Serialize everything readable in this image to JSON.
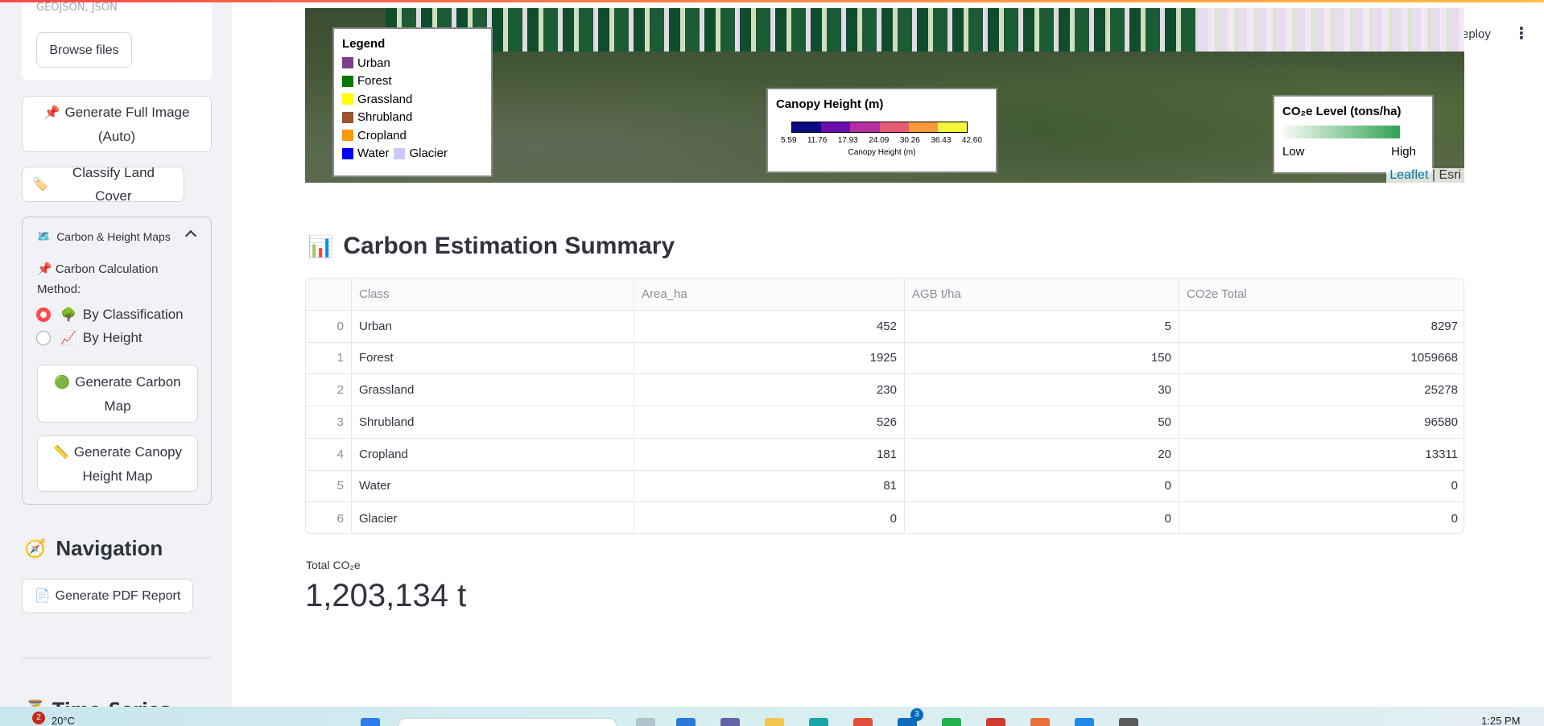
{
  "sidebar": {
    "upload_hint": "GEOJSON, JSON",
    "browse_label": "Browse files",
    "generate_full_label": "Generate Full Image (Auto)",
    "generate_full_emoji": "📌",
    "classify_label": "Classify Land Cover",
    "classify_emoji": "🏷️",
    "expander": {
      "title": "Carbon & Height Maps",
      "emoji": "🗺️",
      "method_label": "📌 Carbon Calculation Method:",
      "options": [
        {
          "emoji": "🌳",
          "label": "By Classification",
          "selected": true
        },
        {
          "emoji": "📈",
          "label": "By Height",
          "selected": false
        }
      ],
      "carbon_btn_emoji": "🟢",
      "carbon_btn_label": "Generate Carbon Map",
      "canopy_btn_emoji": "📏",
      "canopy_btn_label": "Generate Canopy Height Map"
    },
    "nav_title": "Navigation",
    "nav_emoji": "🧭",
    "pdf_emoji": "📄",
    "pdf_label": "Generate PDF Report",
    "cut_title": "⏳ Time-Series Analysis"
  },
  "header": {
    "deploy_label": "eploy",
    "menu_icon": "⋮"
  },
  "map": {
    "legend": {
      "title": "Legend",
      "items": [
        {
          "label": "Urban",
          "color": "#7b3f8c"
        },
        {
          "label": "Forest",
          "color": "#007a00"
        },
        {
          "label": "Grassland",
          "color": "#ffff00"
        },
        {
          "label": "Shrubland",
          "color": "#a0522d"
        },
        {
          "label": "Cropland",
          "color": "#ff9900"
        }
      ],
      "water": {
        "label": "Water",
        "color": "#0000ff"
      },
      "glacier": {
        "label": "Glacier",
        "color": "#c8c8ff"
      }
    },
    "canopy": {
      "title": "Canopy Height (m)",
      "colors": [
        "#0b0b80",
        "#6a0dad",
        "#b52fa0",
        "#e65c6e",
        "#f99a3a",
        "#f5f53b"
      ],
      "ticks": [
        "5.59",
        "11.76",
        "17.93",
        "24.09",
        "30.26",
        "36.43",
        "42.60"
      ],
      "caption": "Canopy Height (m)"
    },
    "co2": {
      "title": "CO₂e Level (tons/ha)",
      "low": "Low",
      "high": "High"
    },
    "attribution": {
      "leaflet": "Leaflet",
      "sep": " | ",
      "esri": "Esri"
    }
  },
  "summary": {
    "title": "Carbon Estimation Summary",
    "emoji": "📊",
    "columns": [
      "Class",
      "Area_ha",
      "AGB t/ha",
      "CO2e Total"
    ],
    "rows": [
      {
        "idx": "0",
        "class": "Urban",
        "area": "452",
        "agb": "5",
        "co2": "8297"
      },
      {
        "idx": "1",
        "class": "Forest",
        "area": "1925",
        "agb": "150",
        "co2": "1059668"
      },
      {
        "idx": "2",
        "class": "Grassland",
        "area": "230",
        "agb": "30",
        "co2": "25278"
      },
      {
        "idx": "3",
        "class": "Shrubland",
        "area": "526",
        "agb": "50",
        "co2": "96580"
      },
      {
        "idx": "4",
        "class": "Cropland",
        "area": "181",
        "agb": "20",
        "co2": "13311"
      },
      {
        "idx": "5",
        "class": "Water",
        "area": "81",
        "agb": "0",
        "co2": "0"
      },
      {
        "idx": "6",
        "class": "Glacier",
        "area": "0",
        "agb": "0",
        "co2": "0"
      }
    ],
    "metric_label": "Total CO₂e",
    "metric_value": "1,203,134 t"
  },
  "taskbar": {
    "weather_badge": "2",
    "weather_temp": "20°C",
    "clock": "1:25 PM",
    "badge_count": "3"
  },
  "colors": {
    "accent": "#ff4b4b",
    "sidebar_bg": "#f0f2f6",
    "text": "#31333f"
  }
}
